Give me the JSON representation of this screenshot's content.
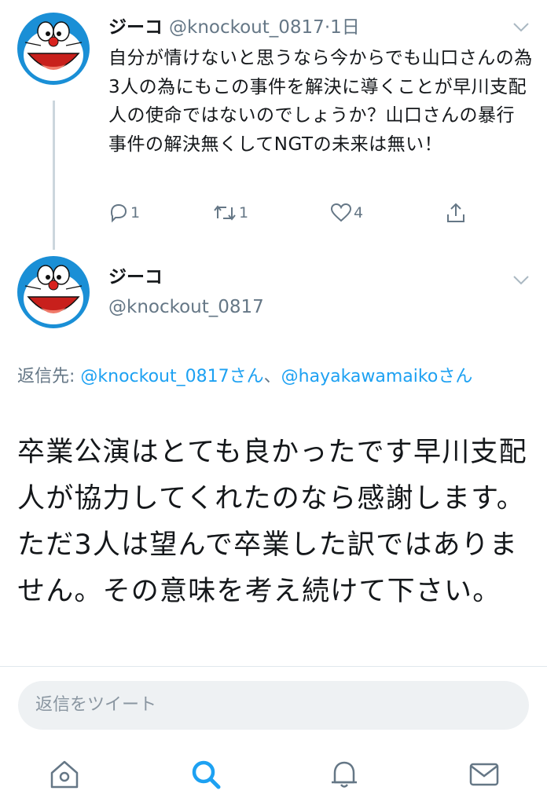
{
  "tweet1": {
    "display_name": "ジーコ",
    "handle": "@knockout_0817",
    "separator": "·",
    "time": "1日",
    "text": "自分が情けないと思うなら今からでも山口さんの為3人の為にもこの事件を解決に導くことが早川支配人の使命ではないのでしょうか？山口さんの暴行事件の解決無くしてNGTの未来は無い！",
    "reply_count": "1",
    "retweet_count": "1",
    "like_count": "4"
  },
  "tweet2": {
    "display_name": "ジーコ",
    "handle": "@knockout_0817",
    "reply_prefix": "返信先: ",
    "mention1": "@knockout_0817さん",
    "mention_sep": "、",
    "mention2": "@hayakawamaikoさん",
    "text": "卒業公演はとても良かったです早川支配人が協力してくれたのなら感謝します。ただ3人は望んで卒業した訳ではありません。その意味を考え続けて下さい。"
  },
  "reply_box": {
    "placeholder": "返信をツイート"
  },
  "icons": {
    "avatar": "doraemon-avatar",
    "chevron": "chevron-down-icon",
    "reply": "reply-icon",
    "retweet": "retweet-icon",
    "like": "heart-icon",
    "share": "share-icon",
    "home": "home-icon",
    "search": "search-icon",
    "notifications": "bell-icon",
    "messages": "mail-icon"
  },
  "colors": {
    "accent": "#1da1f2",
    "secondary_text": "#657786",
    "reply_box_bg": "#eef1f3"
  }
}
